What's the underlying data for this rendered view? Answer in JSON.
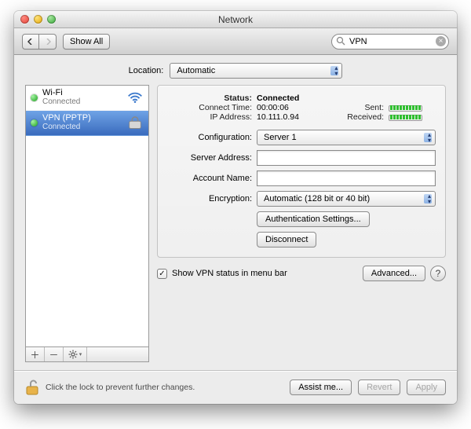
{
  "window": {
    "title": "Network"
  },
  "toolbar": {
    "show_all": "Show All",
    "search_value": "VPN"
  },
  "location": {
    "label": "Location:",
    "value": "Automatic"
  },
  "sidebar": {
    "items": [
      {
        "name": "Wi-Fi",
        "sub": "Connected"
      },
      {
        "name": "VPN (PPTP)",
        "sub": "Connected"
      }
    ]
  },
  "detail": {
    "status_label": "Status:",
    "status_value": "Connected",
    "connect_time_label": "Connect Time:",
    "connect_time_value": "00:00:06",
    "ip_label": "IP Address:",
    "ip_value": "10.111.0.94",
    "sent_label": "Sent:",
    "received_label": "Received:",
    "config_label": "Configuration:",
    "config_value": "Server 1",
    "server_label": "Server Address:",
    "server_value": "",
    "account_label": "Account Name:",
    "account_value": "",
    "encryption_label": "Encryption:",
    "encryption_value": "Automatic (128 bit or 40 bit)",
    "auth_button": "Authentication Settings...",
    "disconnect_button": "Disconnect",
    "show_status_checkbox": "Show VPN status in menu bar",
    "advanced_button": "Advanced...",
    "help": "?"
  },
  "footer": {
    "lock_hint": "Click the lock to prevent further changes.",
    "assist": "Assist me...",
    "revert": "Revert",
    "apply": "Apply"
  }
}
